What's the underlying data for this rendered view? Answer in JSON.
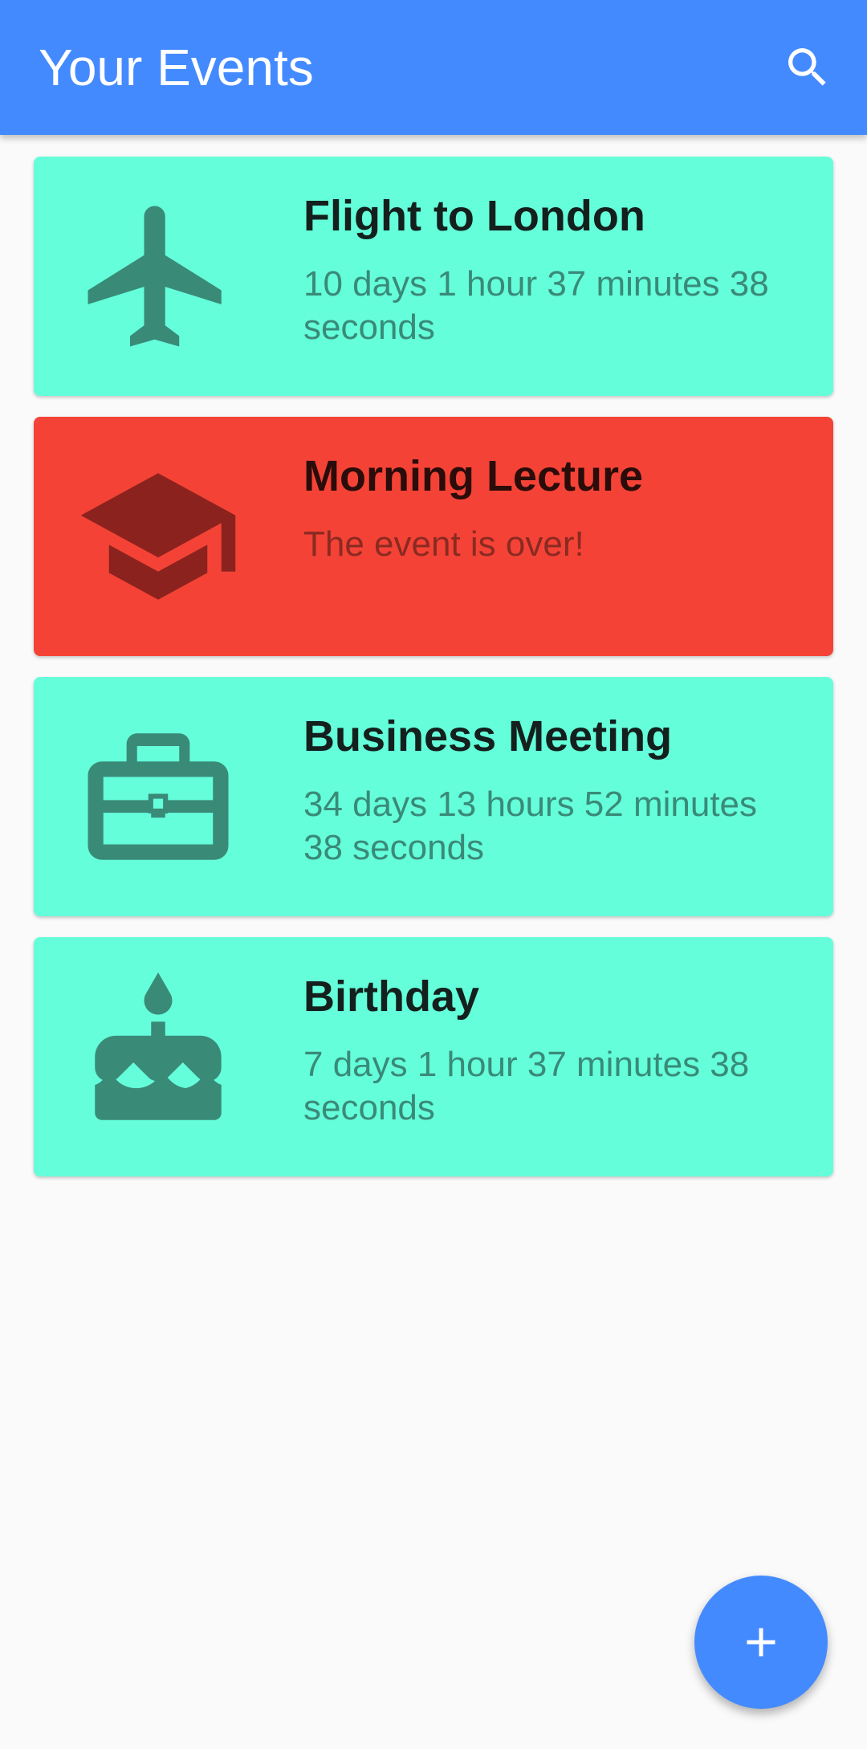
{
  "app_bar": {
    "title": "Your Events",
    "search_icon": "search-icon",
    "color": "#448aff"
  },
  "events": [
    {
      "title": "Flight to London",
      "countdown": "10 days 1 hour 37 minutes 38 seconds",
      "icon": "airplane-icon",
      "status": "upcoming",
      "color": "#64ffda"
    },
    {
      "title": "Morning Lecture",
      "countdown": "The event is over!",
      "icon": "graduation-cap-icon",
      "status": "over",
      "color": "#f44336"
    },
    {
      "title": "Business Meeting",
      "countdown": "34 days 13 hours 52 minutes 38 seconds",
      "icon": "briefcase-icon",
      "status": "upcoming",
      "color": "#64ffda"
    },
    {
      "title": "Birthday",
      "countdown": "7 days 1 hour 37 minutes 38 seconds",
      "icon": "cake-icon",
      "status": "upcoming",
      "color": "#64ffda"
    }
  ],
  "fab": {
    "icon": "plus-icon",
    "color": "#448aff"
  }
}
